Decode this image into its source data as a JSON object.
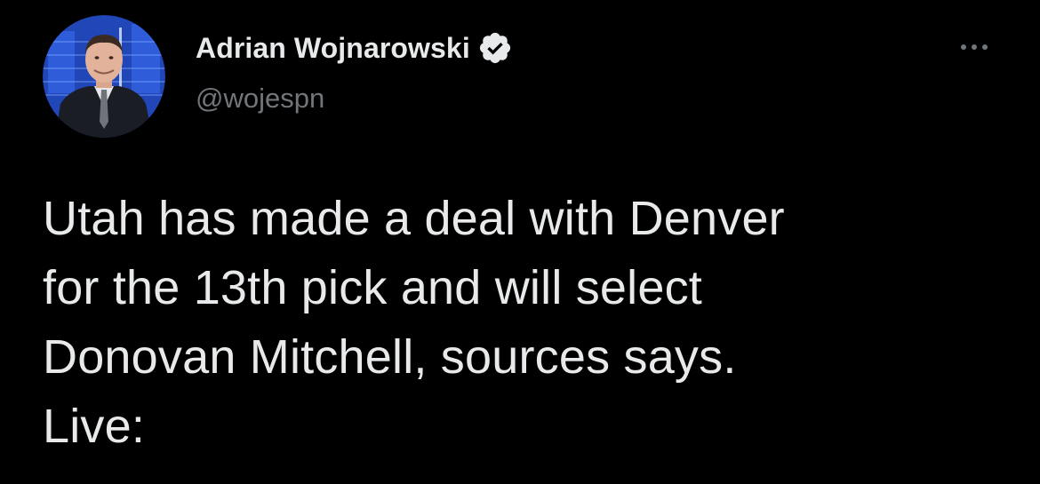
{
  "author": {
    "display_name": "Adrian Wojnarowski",
    "handle": "@wojespn",
    "verified": true,
    "avatar_icon": "profile-photo"
  },
  "menu": {
    "icon": "more-options-icon"
  },
  "tweet": {
    "lines": [
      "Utah has made a deal with Denver",
      "for the 13th pick and will select",
      "Donovan Mitchell, sources says.",
      "Live:"
    ]
  },
  "colors": {
    "background": "#000000",
    "text_primary": "#e7e9ea",
    "text_secondary": "#71767b",
    "verified_badge": "#e7e9ea"
  }
}
